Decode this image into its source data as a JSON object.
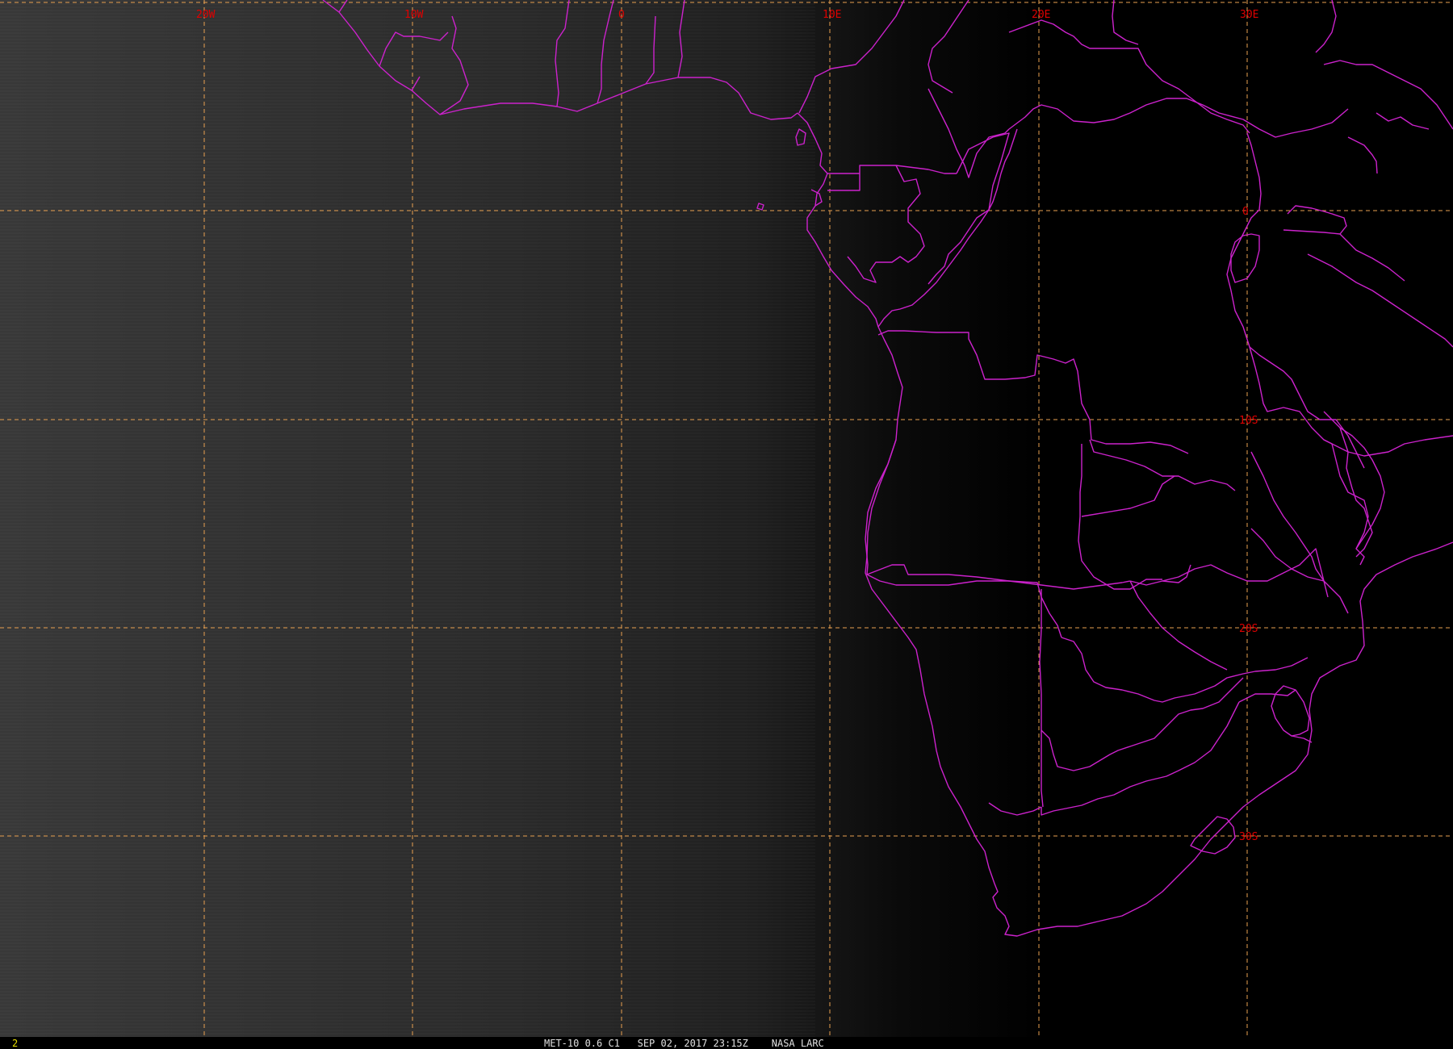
{
  "map": {
    "longitude_labels": [
      "20W",
      "10W",
      "0",
      "10E",
      "20E",
      "30E"
    ],
    "latitude_labels": [
      "0",
      "10S",
      "20S",
      "30S"
    ],
    "status_bar": {
      "frame_number": "2",
      "caption": "MET-10 0.6 C1   SEP 02, 2017 23:15Z    NASA LARC"
    },
    "colors": {
      "background_day": "#363636",
      "background_night": "#000000",
      "grid": "#e8a050",
      "borders": "#cc22cc",
      "labels": "#e00000",
      "frame_number": "#e8e000"
    }
  }
}
